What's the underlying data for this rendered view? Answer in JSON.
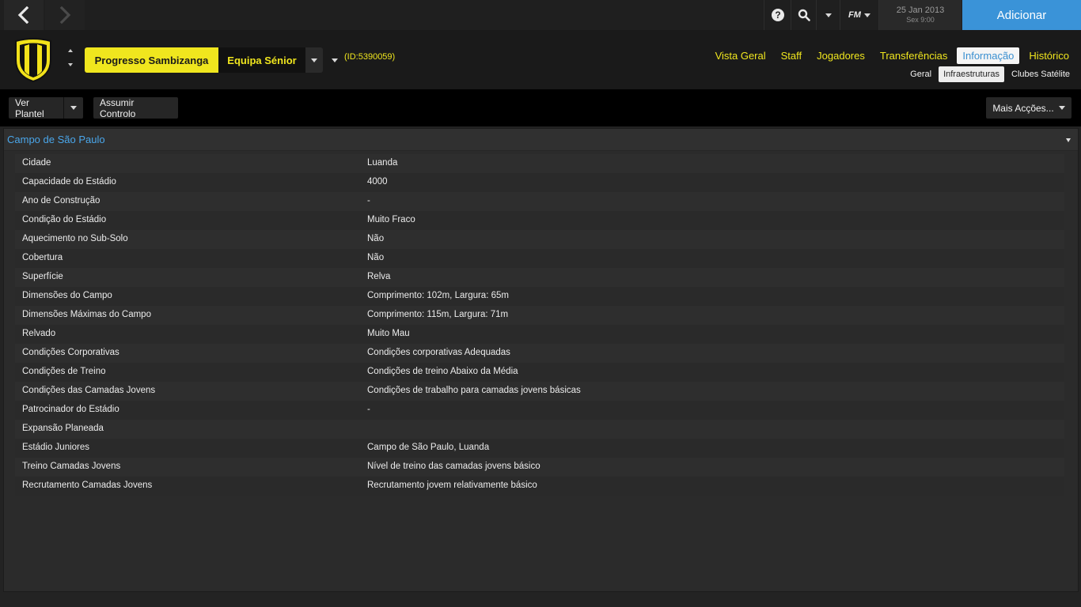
{
  "topbar": {
    "date": "25 Jan 2013",
    "time": "Sex 9:00",
    "fm_label": "FM",
    "add_button": "Adicionar"
  },
  "club": {
    "name": "Progresso Sambizanga",
    "squad": "Equipa Sénior",
    "id": "(ID:5390059)"
  },
  "main_tabs": [
    "Vista Geral",
    "Staff",
    "Jogadores",
    "Transferências",
    "Informação",
    "Histórico"
  ],
  "sub_tabs": [
    "Geral",
    "Infraestruturas",
    "Clubes Satélite"
  ],
  "actions": {
    "view_squad": "Ver Plantel",
    "take_control": "Assumir Controlo",
    "more_actions": "Mais Acções..."
  },
  "panel": {
    "title": "Campo de São Paulo",
    "rows": [
      {
        "label": "Cidade",
        "value": "Luanda"
      },
      {
        "label": "Capacidade do Estádio",
        "value": "4000"
      },
      {
        "label": "Ano de Construção",
        "value": "-"
      },
      {
        "label": "Condição do Estádio",
        "value": "Muito Fraco"
      },
      {
        "label": "Aquecimento no Sub-Solo",
        "value": "Não"
      },
      {
        "label": "Cobertura",
        "value": "Não"
      },
      {
        "label": "Superfície",
        "value": "Relva"
      },
      {
        "label": "Dimensões do Campo",
        "value": "Comprimento: 102m, Largura: 65m"
      },
      {
        "label": "Dimensões Máximas do Campo",
        "value": "Comprimento: 115m, Largura: 71m"
      },
      {
        "label": "Relvado",
        "value": "Muito Mau"
      },
      {
        "label": "Condições Corporativas",
        "value": "Condições corporativas Adequadas"
      },
      {
        "label": "Condições de Treino",
        "value": "Condições de treino Abaixo da Média"
      },
      {
        "label": "Condições das Camadas Jovens",
        "value": "Condições de trabalho para camadas jovens básicas"
      },
      {
        "label": "Patrocinador do Estádio",
        "value": "-"
      },
      {
        "label": "Expansão Planeada",
        "value": ""
      },
      {
        "label": "Estádio Juniores",
        "value": "Campo de São Paulo, Luanda"
      },
      {
        "label": "Treino Camadas Jovens",
        "value": "Nível de treino das camadas jovens básico"
      },
      {
        "label": "Recrutamento Camadas Jovens",
        "value": "Recrutamento jovem relativamente básico"
      }
    ]
  },
  "colors": {
    "accent_yellow": "#f0e61e",
    "accent_blue": "#3a93d8",
    "link_blue": "#4aa6ea"
  }
}
